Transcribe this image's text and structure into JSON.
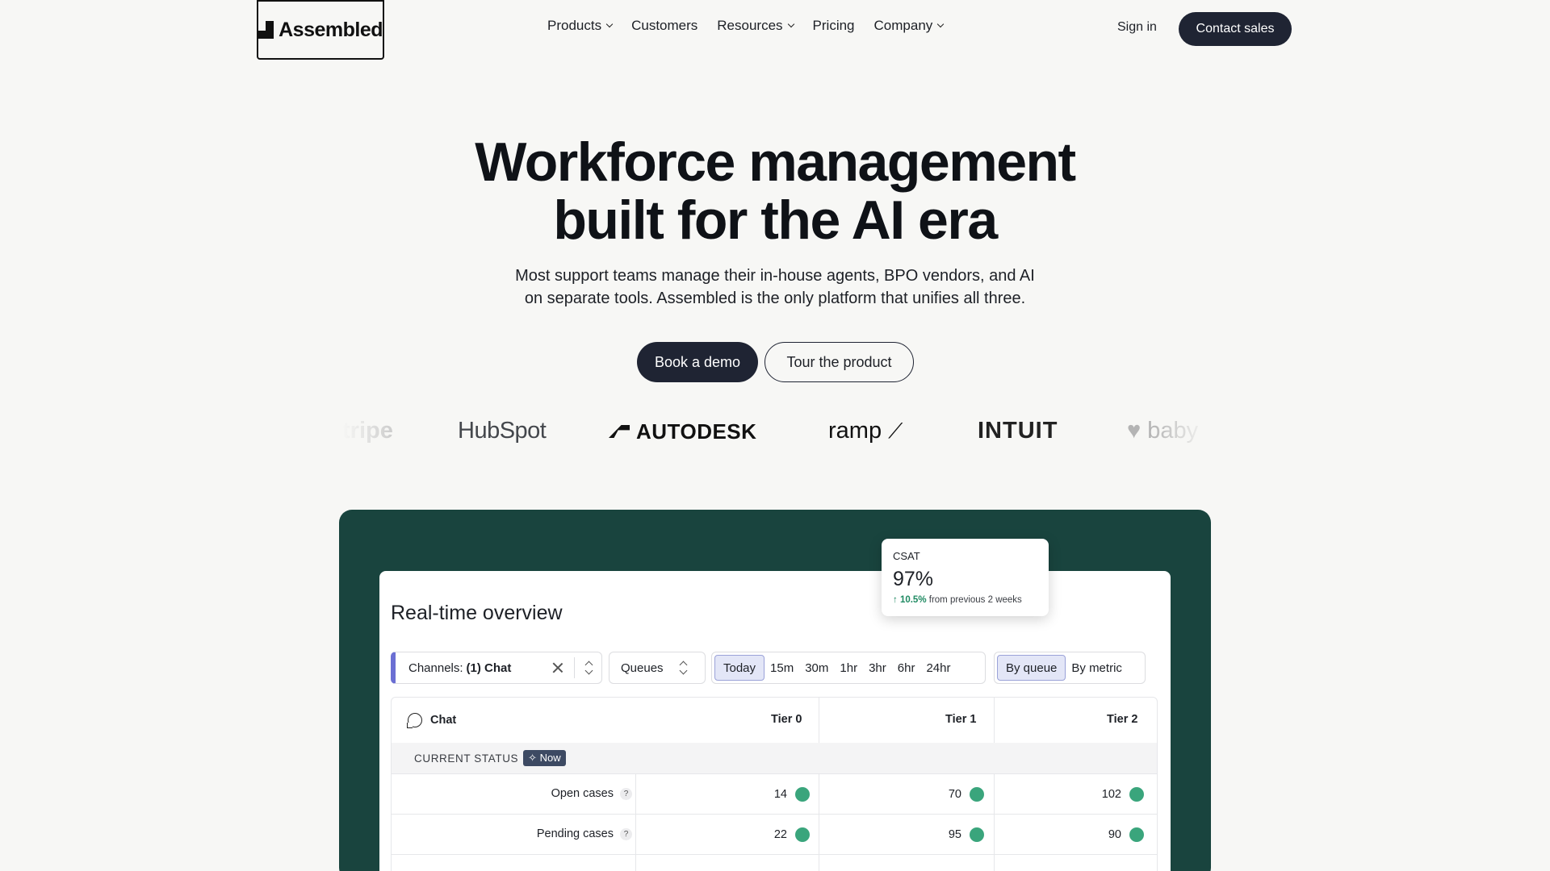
{
  "nav": {
    "logo_text": "Assembled",
    "links": [
      {
        "label": "Products",
        "has_dropdown": true
      },
      {
        "label": "Customers",
        "has_dropdown": false
      },
      {
        "label": "Resources",
        "has_dropdown": true
      },
      {
        "label": "Pricing",
        "has_dropdown": false
      },
      {
        "label": "Company",
        "has_dropdown": true
      }
    ],
    "sign_in": "Sign in",
    "contact_sales": "Contact sales"
  },
  "hero": {
    "title_line1": "Workforce management",
    "title_line2": "built for the AI era",
    "subtitle_line1": "Most support teams manage their in-house agents, BPO vendors, and AI",
    "subtitle_line2": "on separate tools. Assembled is the only platform that unifies all three.",
    "cta_primary": "Book a demo",
    "cta_secondary": "Tour the product"
  },
  "customer_logos": [
    "tripe",
    "HubSpot",
    "AUTODESK",
    "ramp",
    "INTUIT",
    "baby"
  ],
  "dashboard": {
    "title": "Real-time overview",
    "filters": {
      "channels_label": "Channels:",
      "channels_value": "(1) Chat",
      "queues_label": "Queues",
      "time_options": [
        "Today",
        "15m",
        "30m",
        "1hr",
        "3hr",
        "6hr",
        "24hr"
      ],
      "time_selected": "Today",
      "view_options": [
        "By queue",
        "By metric"
      ],
      "view_selected": "By queue"
    },
    "table": {
      "channel": "Chat",
      "columns": [
        "Tier 0",
        "Tier 1",
        "Tier 2"
      ],
      "section_label": "CURRENT STATUS",
      "section_badge": "✧ Now",
      "rows": [
        {
          "label": "Open cases",
          "values": [
            "14",
            "70",
            "102"
          ]
        },
        {
          "label": "Pending cases",
          "values": [
            "22",
            "95",
            "90"
          ]
        }
      ],
      "status_color": "#3aa57c"
    }
  },
  "csat": {
    "label": "CSAT",
    "value": "97%",
    "trend_value": "↑ 10.5%",
    "trend_text": "from previous 2 weeks"
  },
  "colors": {
    "background": "#f7f7f5",
    "primary_dark": "#1f2433",
    "panel_green": "#19443e",
    "accent_purple": "#6b6fd3",
    "positive": "#1f8a62"
  }
}
